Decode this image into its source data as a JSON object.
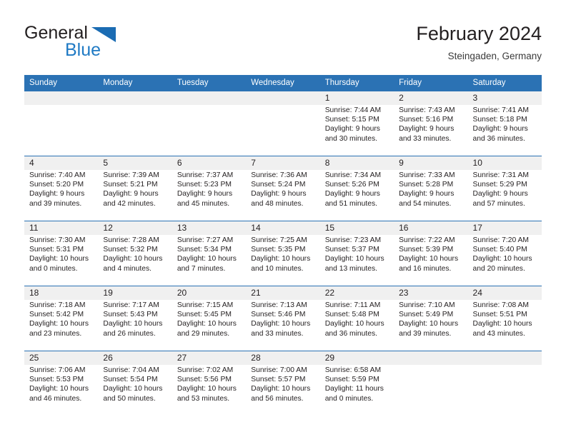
{
  "brand": {
    "name_top": "General",
    "name_bottom": "Blue",
    "triangle_color": "#1b6cb3",
    "blue_text_color": "#1f7ac4"
  },
  "header": {
    "title": "February 2024",
    "subtitle": "Steingaden, Germany"
  },
  "theme": {
    "header_blue": "#2b72b4",
    "daynum_band": "#f0f0f0",
    "text": "#231f20"
  },
  "calendar": {
    "weekdays": [
      "Sunday",
      "Monday",
      "Tuesday",
      "Wednesday",
      "Thursday",
      "Friday",
      "Saturday"
    ],
    "weeks": [
      [
        {
          "day": "",
          "info": ""
        },
        {
          "day": "",
          "info": ""
        },
        {
          "day": "",
          "info": ""
        },
        {
          "day": "",
          "info": ""
        },
        {
          "day": "1",
          "info": "Sunrise: 7:44 AM\nSunset: 5:15 PM\nDaylight: 9 hours\nand 30 minutes."
        },
        {
          "day": "2",
          "info": "Sunrise: 7:43 AM\nSunset: 5:16 PM\nDaylight: 9 hours\nand 33 minutes."
        },
        {
          "day": "3",
          "info": "Sunrise: 7:41 AM\nSunset: 5:18 PM\nDaylight: 9 hours\nand 36 minutes."
        }
      ],
      [
        {
          "day": "4",
          "info": "Sunrise: 7:40 AM\nSunset: 5:20 PM\nDaylight: 9 hours\nand 39 minutes."
        },
        {
          "day": "5",
          "info": "Sunrise: 7:39 AM\nSunset: 5:21 PM\nDaylight: 9 hours\nand 42 minutes."
        },
        {
          "day": "6",
          "info": "Sunrise: 7:37 AM\nSunset: 5:23 PM\nDaylight: 9 hours\nand 45 minutes."
        },
        {
          "day": "7",
          "info": "Sunrise: 7:36 AM\nSunset: 5:24 PM\nDaylight: 9 hours\nand 48 minutes."
        },
        {
          "day": "8",
          "info": "Sunrise: 7:34 AM\nSunset: 5:26 PM\nDaylight: 9 hours\nand 51 minutes."
        },
        {
          "day": "9",
          "info": "Sunrise: 7:33 AM\nSunset: 5:28 PM\nDaylight: 9 hours\nand 54 minutes."
        },
        {
          "day": "10",
          "info": "Sunrise: 7:31 AM\nSunset: 5:29 PM\nDaylight: 9 hours\nand 57 minutes."
        }
      ],
      [
        {
          "day": "11",
          "info": "Sunrise: 7:30 AM\nSunset: 5:31 PM\nDaylight: 10 hours\nand 0 minutes."
        },
        {
          "day": "12",
          "info": "Sunrise: 7:28 AM\nSunset: 5:32 PM\nDaylight: 10 hours\nand 4 minutes."
        },
        {
          "day": "13",
          "info": "Sunrise: 7:27 AM\nSunset: 5:34 PM\nDaylight: 10 hours\nand 7 minutes."
        },
        {
          "day": "14",
          "info": "Sunrise: 7:25 AM\nSunset: 5:35 PM\nDaylight: 10 hours\nand 10 minutes."
        },
        {
          "day": "15",
          "info": "Sunrise: 7:23 AM\nSunset: 5:37 PM\nDaylight: 10 hours\nand 13 minutes."
        },
        {
          "day": "16",
          "info": "Sunrise: 7:22 AM\nSunset: 5:39 PM\nDaylight: 10 hours\nand 16 minutes."
        },
        {
          "day": "17",
          "info": "Sunrise: 7:20 AM\nSunset: 5:40 PM\nDaylight: 10 hours\nand 20 minutes."
        }
      ],
      [
        {
          "day": "18",
          "info": "Sunrise: 7:18 AM\nSunset: 5:42 PM\nDaylight: 10 hours\nand 23 minutes."
        },
        {
          "day": "19",
          "info": "Sunrise: 7:17 AM\nSunset: 5:43 PM\nDaylight: 10 hours\nand 26 minutes."
        },
        {
          "day": "20",
          "info": "Sunrise: 7:15 AM\nSunset: 5:45 PM\nDaylight: 10 hours\nand 29 minutes."
        },
        {
          "day": "21",
          "info": "Sunrise: 7:13 AM\nSunset: 5:46 PM\nDaylight: 10 hours\nand 33 minutes."
        },
        {
          "day": "22",
          "info": "Sunrise: 7:11 AM\nSunset: 5:48 PM\nDaylight: 10 hours\nand 36 minutes."
        },
        {
          "day": "23",
          "info": "Sunrise: 7:10 AM\nSunset: 5:49 PM\nDaylight: 10 hours\nand 39 minutes."
        },
        {
          "day": "24",
          "info": "Sunrise: 7:08 AM\nSunset: 5:51 PM\nDaylight: 10 hours\nand 43 minutes."
        }
      ],
      [
        {
          "day": "25",
          "info": "Sunrise: 7:06 AM\nSunset: 5:53 PM\nDaylight: 10 hours\nand 46 minutes."
        },
        {
          "day": "26",
          "info": "Sunrise: 7:04 AM\nSunset: 5:54 PM\nDaylight: 10 hours\nand 50 minutes."
        },
        {
          "day": "27",
          "info": "Sunrise: 7:02 AM\nSunset: 5:56 PM\nDaylight: 10 hours\nand 53 minutes."
        },
        {
          "day": "28",
          "info": "Sunrise: 7:00 AM\nSunset: 5:57 PM\nDaylight: 10 hours\nand 56 minutes."
        },
        {
          "day": "29",
          "info": "Sunrise: 6:58 AM\nSunset: 5:59 PM\nDaylight: 11 hours\nand 0 minutes."
        },
        {
          "day": "",
          "info": ""
        },
        {
          "day": "",
          "info": ""
        }
      ]
    ]
  }
}
